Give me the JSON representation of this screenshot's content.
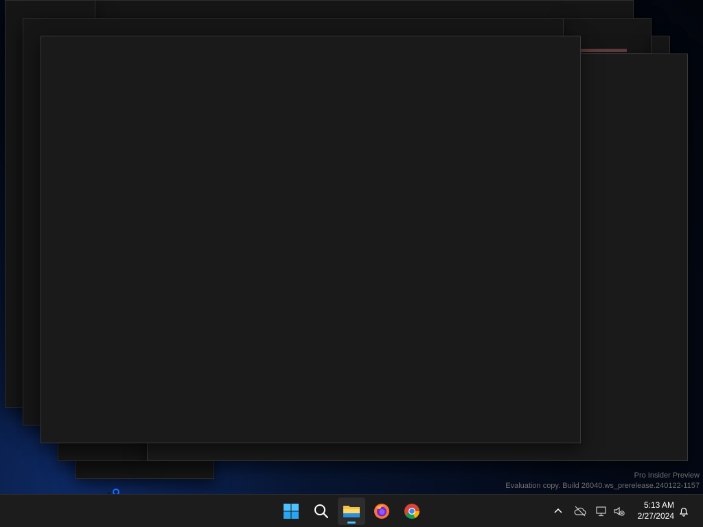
{
  "taskbar": {
    "apps": [
      {
        "name": "start",
        "icon": "windows-logo-icon"
      },
      {
        "name": "search",
        "icon": "search-icon"
      },
      {
        "name": "file-explorer",
        "icon": "folder-icon",
        "active": true
      },
      {
        "name": "firefox",
        "icon": "firefox-icon"
      },
      {
        "name": "chrome",
        "icon": "chrome-icon"
      }
    ],
    "tray": {
      "time": "5:13 AM",
      "date": "2/27/2024"
    }
  },
  "watermark": {
    "line1": "Pro Insider Preview",
    "line2": "Evaluation copy. Build 26040.ws_prerelease.240122-1157"
  },
  "colors": {
    "accent": "#4cc2ff",
    "window_bg": "#1a1a1a",
    "taskbar_bg": "#1c1c1c"
  }
}
